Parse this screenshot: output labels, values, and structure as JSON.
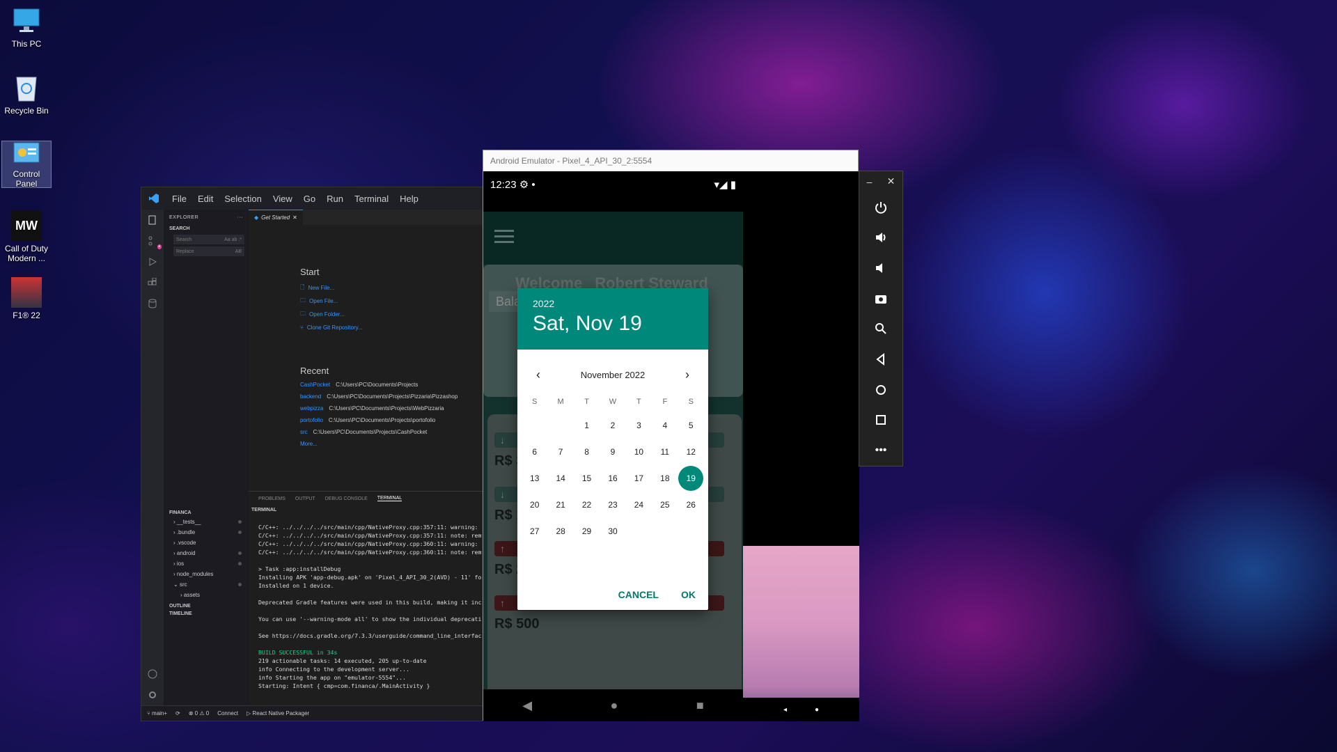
{
  "desktop": {
    "icons": [
      {
        "label": "This PC"
      },
      {
        "label": "Recycle Bin"
      },
      {
        "label": "Control Panel"
      },
      {
        "label": "Call of Duty Modern ..."
      },
      {
        "label": "F1® 22"
      }
    ]
  },
  "vscode": {
    "menu": [
      "File",
      "Edit",
      "Selection",
      "View",
      "Go",
      "Run",
      "Terminal",
      "Help"
    ],
    "sidebar": {
      "explorer_label": "EXPLORER",
      "search_label": "SEARCH",
      "search_placeholder": "Search",
      "replace_placeholder": "Replace",
      "folder_label": "FINANCA",
      "tree": [
        "__tests__",
        ".bundle",
        ".vscode",
        "android",
        "ios",
        "node_modules",
        "src",
        "assets"
      ],
      "outline_label": "OUTLINE",
      "timeline_label": "TIMELINE"
    },
    "tab": "Get Started",
    "start": {
      "title": "Start",
      "links": [
        "New File...",
        "Open File...",
        "Open Folder...",
        "Clone Git Repository..."
      ]
    },
    "recent": {
      "title": "Recent",
      "items": [
        {
          "name": "CashPocket",
          "path": "C:\\Users\\PC\\Documents\\Projects"
        },
        {
          "name": "backend",
          "path": "C:\\Users\\PC\\Documents\\Projects\\Pizzaria\\Pizzashop"
        },
        {
          "name": "webpizza",
          "path": "C:\\Users\\PC\\Documents\\Projects\\WebPizzaria"
        },
        {
          "name": "portofolio",
          "path": "C:\\Users\\PC\\Documents\\Projects\\portofolio"
        },
        {
          "name": "src",
          "path": "C:\\Users\\PC\\Documents\\Projects\\CashPocket"
        }
      ],
      "more": "More..."
    },
    "panel_tabs": [
      "PROBLEMS",
      "OUTPUT",
      "DEBUG CONSOLE",
      "TERMINAL"
    ],
    "terminal_label": "TERMINAL",
    "terminal_lines": [
      "C/C++: ../../../../src/main/cpp/NativeProxy.cpp:357:11: warning:",
      "C/C++: ../../../../src/main/cpp/NativeProxy.cpp:357:11: note: rem",
      "C/C++: ../../../../src/main/cpp/NativeProxy.cpp:360:11: warning:",
      "C/C++: ../../../../src/main/cpp/NativeProxy.cpp:360:11: note: rem",
      "",
      "> Task :app:installDebug",
      "Installing APK 'app-debug.apk' on 'Pixel_4_API_30_2(AVD) - 11' fo",
      "Installed on 1 device.",
      "",
      "Deprecated Gradle features were used in this build, making it inc",
      "",
      "You can use '--warning-mode all' to show the individual deprecati",
      "",
      "See https://docs.gradle.org/7.3.3/userguide/command_line_interfac",
      "",
      "BUILD SUCCESSFUL in 34s",
      "219 actionable tasks: 14 executed, 205 up-to-date",
      "info Connecting to the development server...",
      "info Starting the app on \"emulator-5554\"...",
      "Starting: Intent { cmp=com.financa/.MainActivity }"
    ],
    "status": {
      "branch": "main+",
      "problems": "⊗ 0 ⚠ 0",
      "connect": "Connect",
      "packager": "React Native Packager"
    }
  },
  "emulator": {
    "title": "Android Emulator - Pixel_4_API_30_2:5554",
    "status_time": "12:23",
    "welcome": "Welcome",
    "user_name": "Robert Steward",
    "balance_label": "Bala",
    "amounts": [
      "R$ 3",
      "R$ 1",
      "R$ 2",
      "R$ 500"
    ],
    "datepicker": {
      "year": "2022",
      "selected_date": "Sat, Nov 19",
      "month_label": "November 2022",
      "weekdays": [
        "S",
        "M",
        "T",
        "W",
        "T",
        "F",
        "S"
      ],
      "weeks": [
        [
          "",
          "",
          "1",
          "2",
          "3",
          "4",
          "5"
        ],
        [
          "6",
          "7",
          "8",
          "9",
          "10",
          "11",
          "12"
        ],
        [
          "13",
          "14",
          "15",
          "16",
          "17",
          "18",
          "19"
        ],
        [
          "20",
          "21",
          "22",
          "23",
          "24",
          "25",
          "26"
        ],
        [
          "27",
          "28",
          "29",
          "30",
          "",
          "",
          ""
        ]
      ],
      "selected_day": "19",
      "cancel": "CANCEL",
      "ok": "OK"
    },
    "accent_color": "#00897b"
  }
}
